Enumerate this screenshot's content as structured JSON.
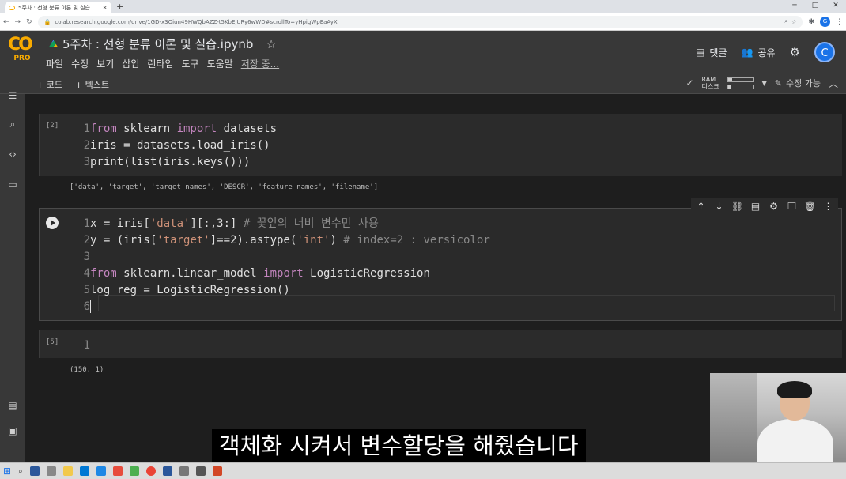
{
  "browser": {
    "tab_title": "5주차 : 선형 분류 이론 및 실습.",
    "tab_close": "×",
    "new_tab": "+",
    "url": "colab.research.google.com/drive/1GD-x3Oiun49HWQbAZZ-t5KbEjURy6wWD#scrollTo=yHpigWpEaAyX"
  },
  "colab": {
    "logo_text": "CO",
    "pro_label": "PRO",
    "title": "5주차 : 선형 분류 이론 및 실습.ipynb",
    "menu": [
      "파일",
      "수정",
      "보기",
      "삽입",
      "런타임",
      "도구",
      "도움말"
    ],
    "saving": "저장 중...",
    "comment_label": "댓글",
    "share_label": "공유",
    "avatar_initial": "C"
  },
  "toolbar": {
    "add_code": "+ 코드",
    "add_text": "+ 텍스트",
    "ram_label": "RAM",
    "disk_label": "디스크",
    "ram_usage": 0.18,
    "disk_usage": 0.1,
    "edit_label": "수정 가능"
  },
  "cells": [
    {
      "exec_label": "[2]",
      "lines": [
        {
          "num": "1",
          "parts": [
            [
              "kw",
              "from"
            ],
            [
              "",
              " sklearn "
            ],
            [
              "kw",
              "import"
            ],
            [
              "",
              " datasets"
            ]
          ]
        },
        {
          "num": "2",
          "parts": [
            [
              "",
              "iris = datasets.load_iris()"
            ]
          ]
        },
        {
          "num": "3",
          "parts": [
            [
              "",
              "print(list(iris.keys()))"
            ]
          ]
        }
      ],
      "output": "['data', 'target', 'target_names', 'DESCR', 'feature_names', 'filename']"
    },
    {
      "exec_label": "",
      "lines": [
        {
          "num": "1",
          "parts": [
            [
              "",
              "x = iris["
            ],
            [
              "str",
              "'data'"
            ],
            [
              "",
              "][:,3:] "
            ],
            [
              "cm",
              "# 꽃잎의 너비 변수만 사용"
            ]
          ]
        },
        {
          "num": "2",
          "parts": [
            [
              "",
              "y = (iris["
            ],
            [
              "str",
              "'target'"
            ],
            [
              "",
              "]==2).astype("
            ],
            [
              "str",
              "'int'"
            ],
            [
              "",
              ") "
            ],
            [
              "cm",
              "# index=2 : versicolor"
            ]
          ]
        },
        {
          "num": "3",
          "parts": [
            [
              "",
              ""
            ]
          ]
        },
        {
          "num": "4",
          "parts": [
            [
              "kw",
              "from"
            ],
            [
              "",
              " sklearn.linear_model "
            ],
            [
              "kw",
              "import"
            ],
            [
              "",
              " LogisticRegression"
            ]
          ]
        },
        {
          "num": "5",
          "parts": [
            [
              "",
              "log_reg = LogisticRegression()"
            ]
          ]
        },
        {
          "num": "6",
          "parts": [
            [
              "",
              ""
            ]
          ]
        }
      ],
      "output": ""
    },
    {
      "exec_label": "[5]",
      "lines": [
        {
          "num": "1",
          "parts": [
            [
              "",
              ""
            ]
          ]
        }
      ],
      "output": "(150, 1)"
    }
  ],
  "subtitle": "객체화 시켜서 변수할당을 해줬습니다",
  "icons": {
    "sidebar": [
      "toc-icon",
      "search-icon",
      "code-snippets-icon",
      "files-icon",
      "command-palette-icon",
      "terminal-icon"
    ],
    "cell_toolbar": [
      "arrow-up-icon",
      "arrow-down-icon",
      "link-icon",
      "comment-icon",
      "gear-icon",
      "mirror-icon",
      "delete-icon",
      "more-icon"
    ]
  }
}
